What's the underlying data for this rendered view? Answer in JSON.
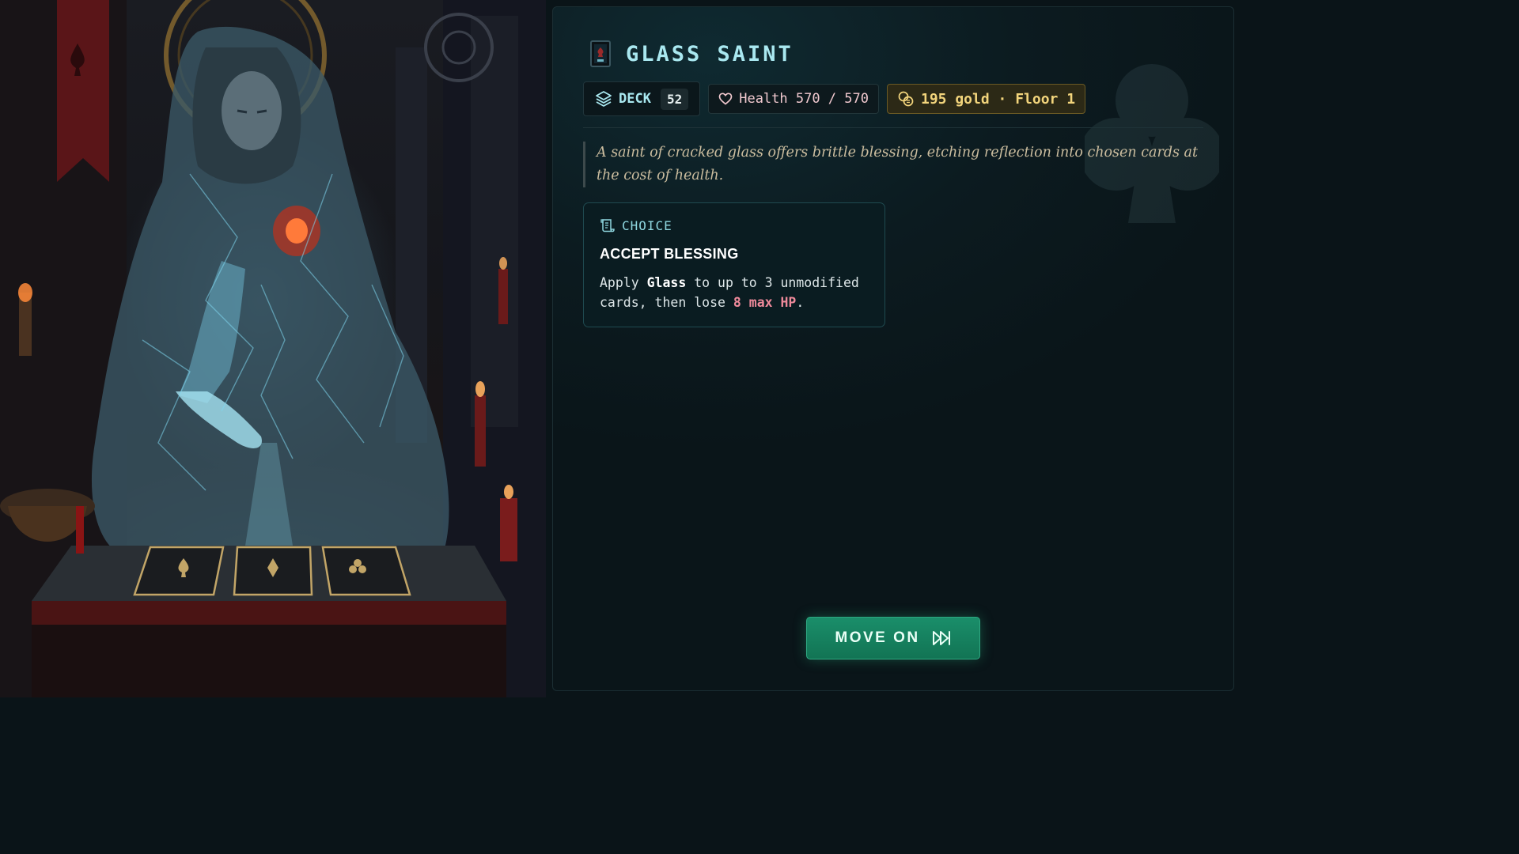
{
  "event": {
    "title": "GLASS SAINT",
    "flavor": "A saint of cracked glass offers brittle blessing, etching reflection into chosen cards at the cost of health."
  },
  "stats": {
    "deck_label": "DECK",
    "deck_count": "52",
    "health_text": "Health 570 / 570",
    "gold_text": "195 gold · Floor 1"
  },
  "choice": {
    "kicker": "CHOICE",
    "title": "ACCEPT BLESSING",
    "desc_prefix": "Apply ",
    "desc_keyword": "Glass",
    "desc_middle": " to up to 3 unmodified cards, then lose ",
    "desc_cost": "8 max HP",
    "desc_suffix": "."
  },
  "actions": {
    "move_on_label": "MOVE ON"
  },
  "colors": {
    "title": "#a9e8f0",
    "gold": "#f3d57c",
    "health": "#f1c9cf",
    "cost": "#ef8a9b",
    "button": "#1a8e6a"
  },
  "icons": {
    "title": "card-event-icon",
    "deck": "stacked-layers-icon",
    "health": "heart-icon",
    "gold": "coins-icon",
    "choice": "scroll-icon",
    "move_on": "fast-forward-icon",
    "watermark": "club-suit-icon"
  },
  "artwork": {
    "subject": "glass saint"
  }
}
